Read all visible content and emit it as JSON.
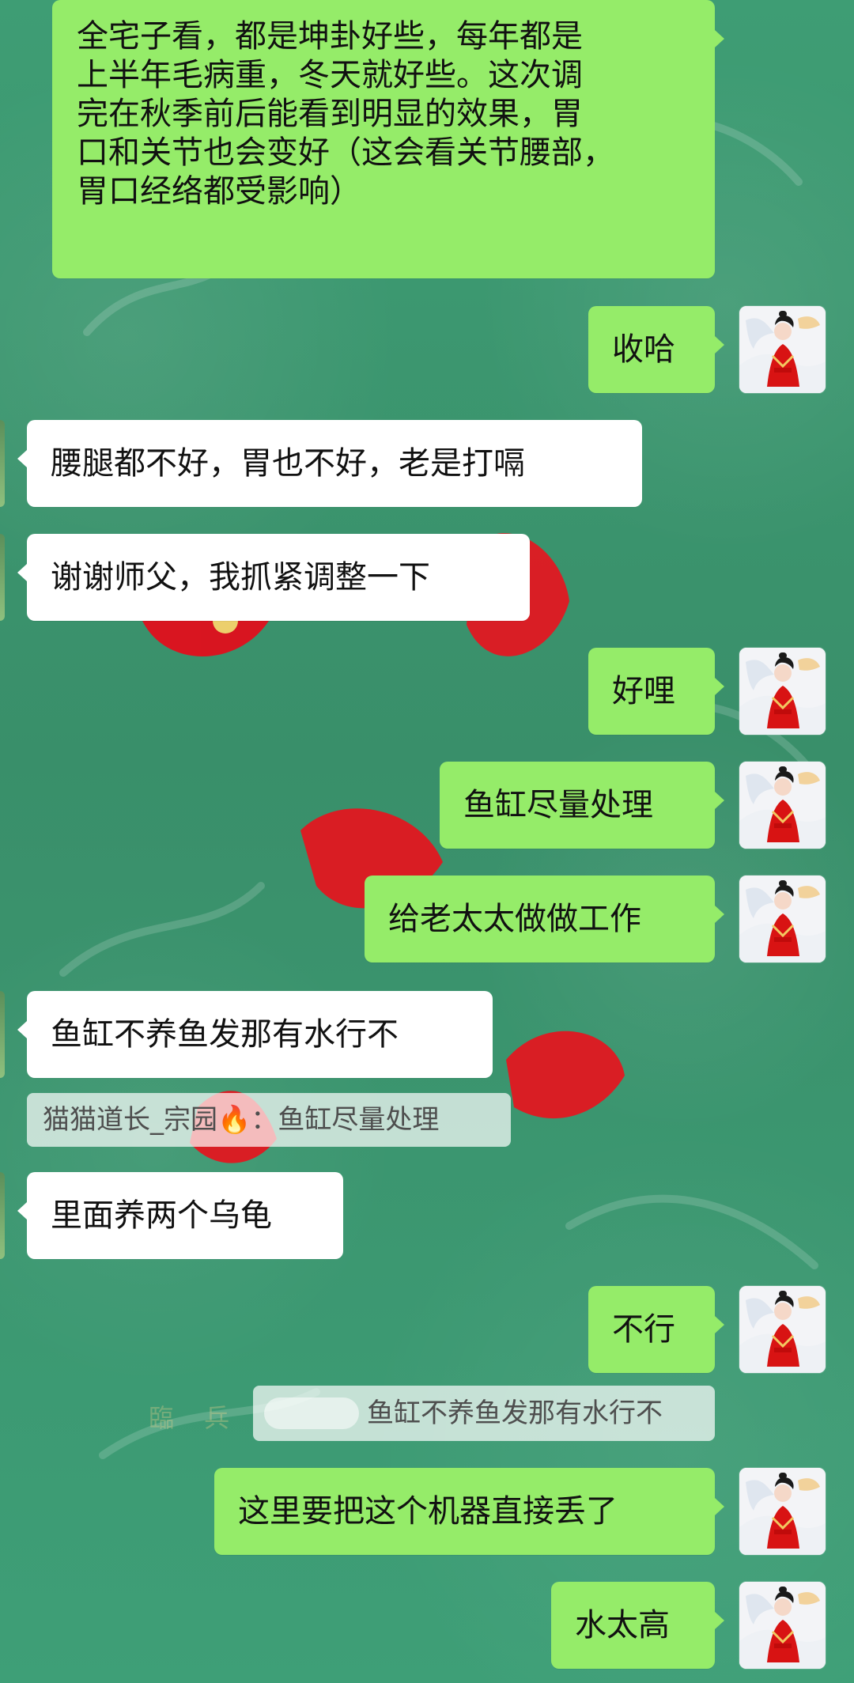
{
  "chat": {
    "messages": [
      {
        "id": "m1",
        "side": "right",
        "text": "全宅子看，都是坤卦好些，每年都是上半年毛病重，冬天就好些。这次调完在秋季前后能看到明显的效果，胃口和关节也会变好（这会看关节腰部，胃口经络都受影响）",
        "lines": [
          "全宅子看，都是坤卦好些，每年都是",
          "上半年毛病重，冬天就好些。这次调",
          "完在秋季前后能看到明显的效果，胃",
          "口和关节也会变好（这会看关节腰部，",
          "胃口经络都受影响）"
        ]
      },
      {
        "id": "m2",
        "side": "right",
        "text": "收哈"
      },
      {
        "id": "m3",
        "side": "left",
        "text": "腰腿都不好，胃也不好，老是打嗝"
      },
      {
        "id": "m4",
        "side": "left",
        "text": "谢谢师父，我抓紧调整一下"
      },
      {
        "id": "m5",
        "side": "right",
        "text": "好哩"
      },
      {
        "id": "m6",
        "side": "right",
        "text": "鱼缸尽量处理"
      },
      {
        "id": "m7",
        "side": "right",
        "text": "给老太太做做工作"
      },
      {
        "id": "m8",
        "side": "left",
        "text": "鱼缸不养鱼发那有水行不"
      },
      {
        "id": "q1",
        "type": "quote",
        "text": "猫猫道长_宗园🔥：鱼缸尽量处理"
      },
      {
        "id": "m9",
        "side": "left",
        "text": "里面养两个乌龟"
      },
      {
        "id": "m10",
        "side": "right",
        "text": "不行"
      },
      {
        "id": "q2",
        "type": "quote",
        "text": "鱼缸不养鱼发那有水行不"
      },
      {
        "id": "m11",
        "side": "right",
        "text": "这里要把这个机器直接丢了"
      },
      {
        "id": "m12",
        "side": "right",
        "text": "水太高"
      }
    ]
  },
  "background": {
    "decor_text": "臨  兵"
  },
  "icons": {
    "avatar": "avatar-icon",
    "flame": "flame-icon"
  },
  "colors": {
    "background": "#3c9a72",
    "sent_bubble": "#95ec69",
    "received_bubble": "#ffffff",
    "quote_bg": "#ffffff"
  }
}
